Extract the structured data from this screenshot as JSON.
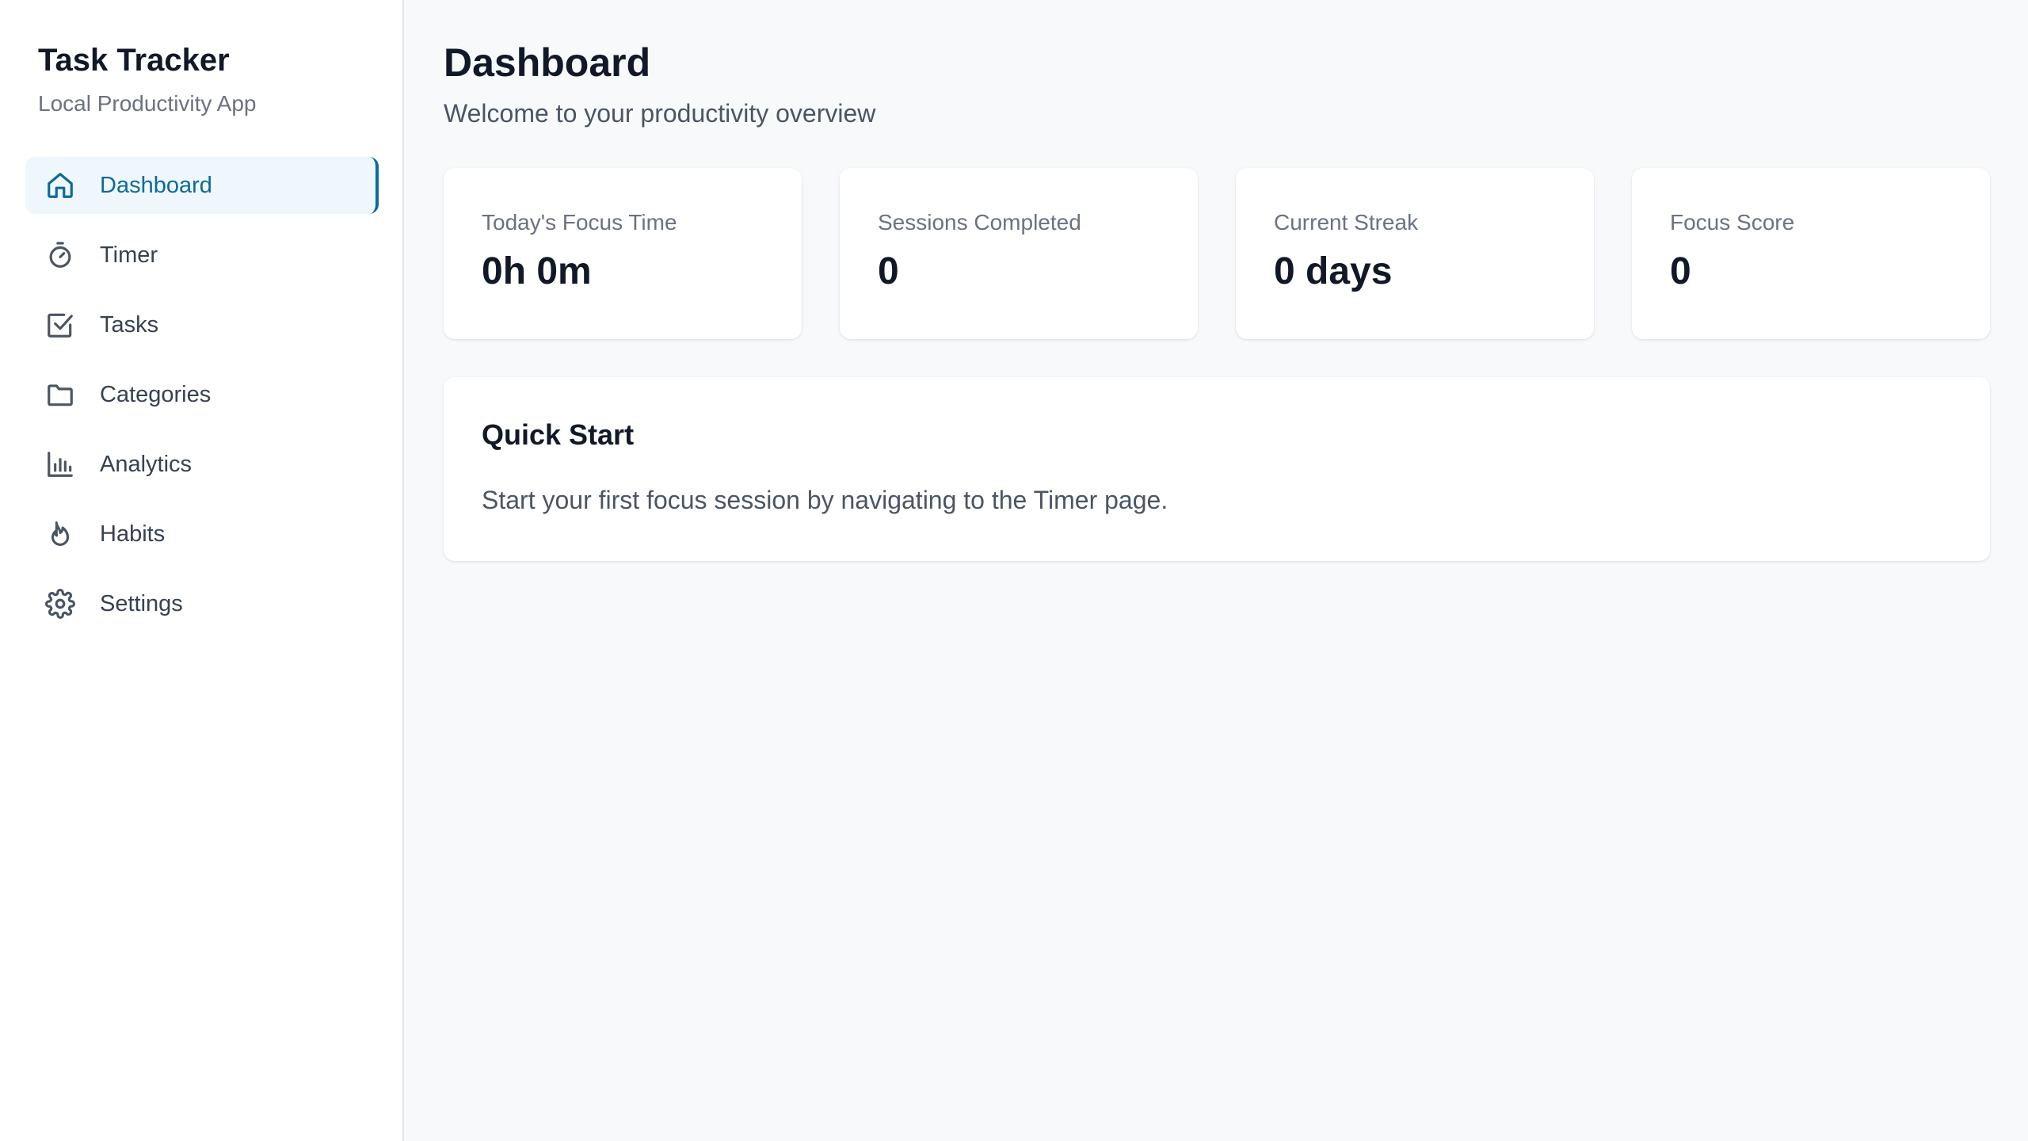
{
  "sidebar": {
    "title": "Task Tracker",
    "subtitle": "Local Productivity App",
    "items": [
      {
        "label": "Dashboard",
        "icon": "home-icon",
        "active": true
      },
      {
        "label": "Timer",
        "icon": "stopwatch-icon",
        "active": false
      },
      {
        "label": "Tasks",
        "icon": "checkbox-icon",
        "active": false
      },
      {
        "label": "Categories",
        "icon": "folder-icon",
        "active": false
      },
      {
        "label": "Analytics",
        "icon": "bar-chart-icon",
        "active": false
      },
      {
        "label": "Habits",
        "icon": "flame-icon",
        "active": false
      },
      {
        "label": "Settings",
        "icon": "gear-icon",
        "active": false
      }
    ]
  },
  "main": {
    "title": "Dashboard",
    "subtitle": "Welcome to your productivity overview",
    "stats": [
      {
        "label": "Today's Focus Time",
        "value": "0h 0m"
      },
      {
        "label": "Sessions Completed",
        "value": "0"
      },
      {
        "label": "Current Streak",
        "value": "0 days"
      },
      {
        "label": "Focus Score",
        "value": "0"
      }
    ],
    "quick_start": {
      "title": "Quick Start",
      "text": "Start your first focus session by navigating to the Timer page."
    }
  },
  "colors": {
    "accent": "#0a6b99",
    "active_bg": "#eff7fd",
    "page_bg": "#f8f9fb"
  }
}
